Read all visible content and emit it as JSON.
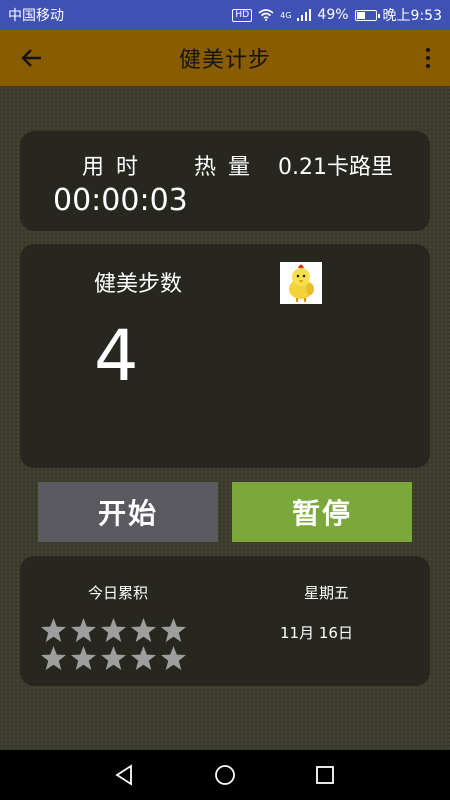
{
  "status_bar": {
    "carrier": "中国移动",
    "hd_badge": "HD",
    "network": "4G",
    "battery_percent": "49%",
    "battery_level": 0.49,
    "time": "晚上9:53"
  },
  "app_bar": {
    "title": "健美计步",
    "back_icon": "arrow-left-icon",
    "more_icon": "more-vert-icon"
  },
  "time_card": {
    "time_label": "用时",
    "time_value": "00:00:03",
    "calorie_label": "热量",
    "calorie_value": "0.21卡路里"
  },
  "steps_card": {
    "steps_label": "健美步数",
    "steps_value": "4",
    "mascot_icon": "yellow-chick-icon"
  },
  "buttons": {
    "start_label": "开始",
    "pause_label": "暂停"
  },
  "stats_card": {
    "today_label": "今日累积",
    "weekday": "星期五",
    "date": "11月 16日",
    "rating": 0,
    "rating_max": 10
  },
  "colors": {
    "status_bar": "#3f51b5",
    "app_bar": "#8a5c00",
    "card": "#272720",
    "start_button": "#5a5a60",
    "pause_button": "#7aa83a",
    "star_empty": "#9e9e9e"
  },
  "nav_bar": {
    "back_icon": "triangle-back-icon",
    "home_icon": "circle-home-icon",
    "recents_icon": "square-recents-icon"
  }
}
